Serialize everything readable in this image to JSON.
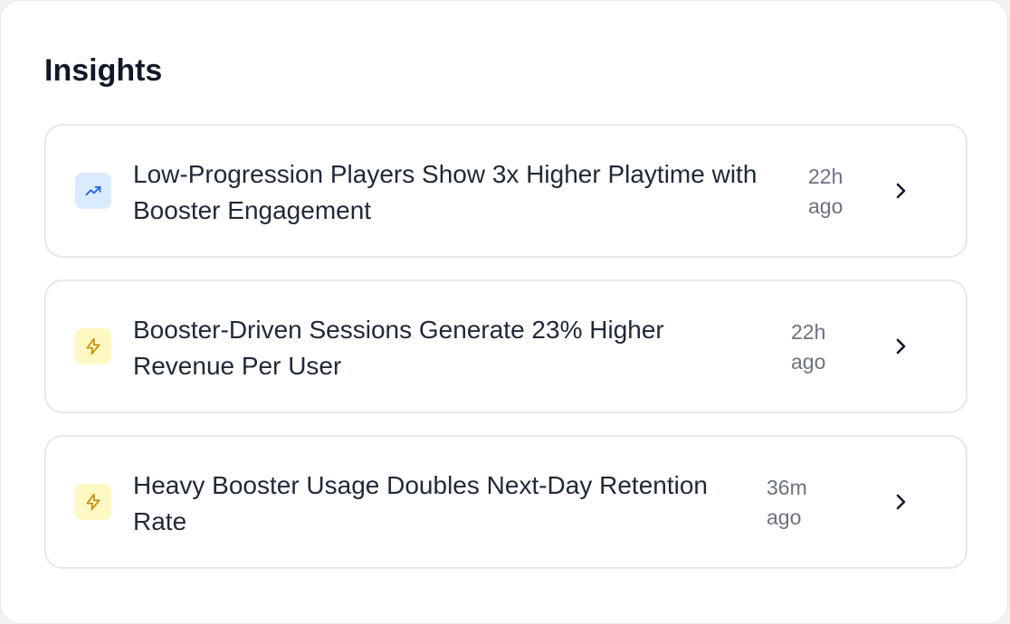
{
  "panel": {
    "title": "Insights"
  },
  "insights": [
    {
      "icon": "trending-up-icon",
      "icon_color": "#2563eb",
      "icon_bg": "#dbeafe",
      "title": "Low-Progression Players Show 3x Higher Playtime with Booster Engagement",
      "time": "22h ago"
    },
    {
      "icon": "lightning-icon",
      "icon_color": "#ca8a04",
      "icon_bg": "#fef9c3",
      "title": "Booster-Driven Sessions Generate 23% Higher Revenue Per User",
      "time": "22h ago"
    },
    {
      "icon": "lightning-icon",
      "icon_color": "#ca8a04",
      "icon_bg": "#fef9c3",
      "title": "Heavy Booster Usage Doubles Next-Day Retention Rate",
      "time": "36m ago"
    }
  ]
}
